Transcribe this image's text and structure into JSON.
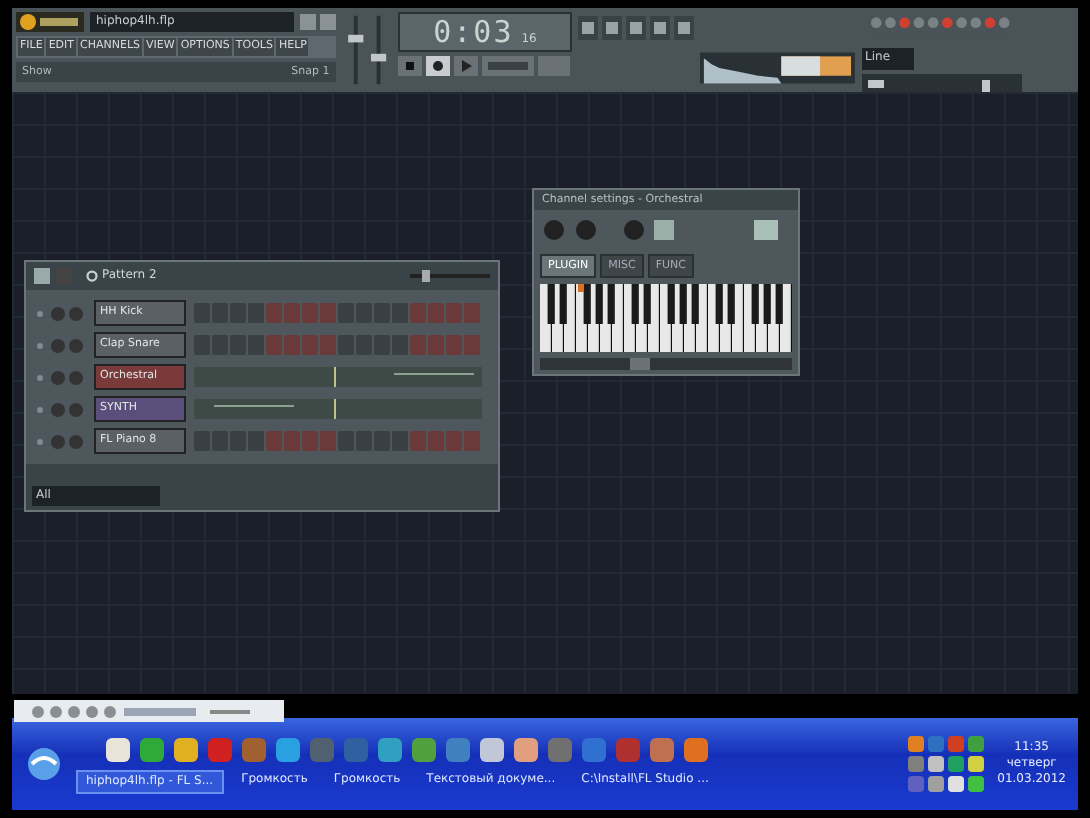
{
  "toolbar": {
    "project": "hiphop4lh.flp",
    "menu": [
      "FILE",
      "EDIT",
      "CHANNELS",
      "VIEW",
      "OPTIONS",
      "TOOLS",
      "HELP"
    ],
    "hint_left": "Show",
    "hint_right": "Snap 1",
    "time": "0:03",
    "time_sub": "16",
    "snap_field": "Line"
  },
  "step_sequencer": {
    "pattern": "Pattern 2",
    "footer": "All",
    "channels": [
      {
        "name": "HH Kick",
        "kind": "steps",
        "color": "#5a6166"
      },
      {
        "name": "Clap Snare",
        "kind": "steps",
        "color": "#5a6166"
      },
      {
        "name": "Orchestral",
        "kind": "roll",
        "color": "#7a3a3a"
      },
      {
        "name": "SYNTH",
        "kind": "roll",
        "color": "#5a4f7a"
      },
      {
        "name": "FL Piano 8",
        "kind": "steps",
        "color": "#5a6166"
      }
    ]
  },
  "channel_settings": {
    "title": "Channel settings - Orchestral",
    "tabs": [
      {
        "label": "PLUGIN",
        "selected": true
      },
      {
        "label": "MISC",
        "selected": false
      },
      {
        "label": "FUNC",
        "selected": false
      }
    ]
  },
  "taskbar": {
    "tasks": [
      {
        "label": "hiphop4lh.flp - FL S...",
        "selected": true
      },
      {
        "label": "Громкость",
        "selected": false
      },
      {
        "label": "Громкость",
        "selected": false
      },
      {
        "label": "Текстовый докуме...",
        "selected": false
      },
      {
        "label": "C:\\Install\\FL Studio ...",
        "selected": false
      }
    ],
    "clock": {
      "time": "11:35",
      "day": "четверг",
      "date": "01.03.2012"
    }
  }
}
